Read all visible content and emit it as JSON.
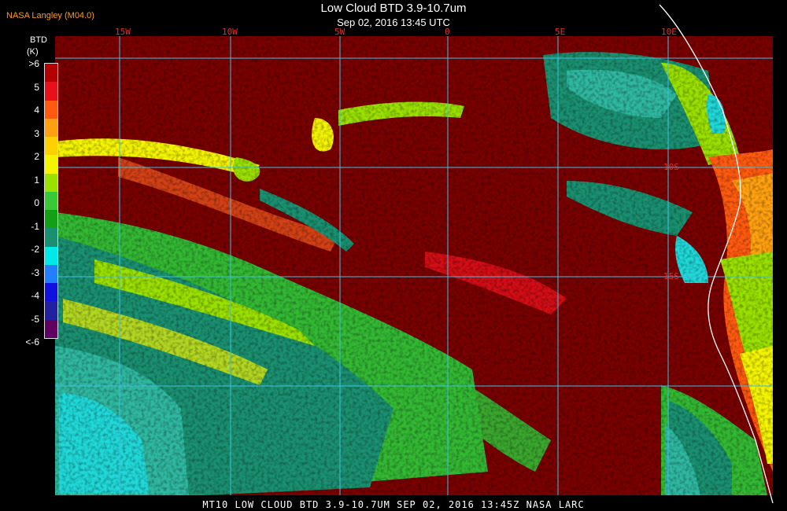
{
  "header": {
    "title": "Low Cloud BTD 3.9-10.7um",
    "subtitle": "Sep 02, 2016 13:45 UTC",
    "provider": "NASA Langley (M04.0)"
  },
  "legend": {
    "label": "BTD",
    "unit": "(K)",
    "ticks": [
      ">6",
      "5",
      "4",
      "3",
      "2",
      "1",
      "0",
      "-1",
      "-2",
      "-3",
      "-4",
      "-5",
      "<-6"
    ],
    "colors": [
      "#b40000",
      "#e8101a",
      "#ff5a10",
      "#ffa010",
      "#ffd000",
      "#f4f400",
      "#9ae000",
      "#38c838",
      "#14a014",
      "#1a9070",
      "#00e8e8",
      "#2080ff",
      "#1010e0",
      "#2020a0",
      "#600060"
    ]
  },
  "grid": {
    "lon_labels": [
      "15W",
      "10W",
      "5W",
      "0",
      "5E",
      "10E"
    ],
    "lat_labels": [
      "10S",
      "15S"
    ]
  },
  "palette": {
    "background": "#7a0000",
    "gridline": "#40c0e0",
    "coastline": "#ffffff"
  },
  "footer": {
    "text": "MT10  LOW CLOUD BTD 3.9-10.7UM   SEP 02, 2016 13:45Z   NASA LARC"
  }
}
